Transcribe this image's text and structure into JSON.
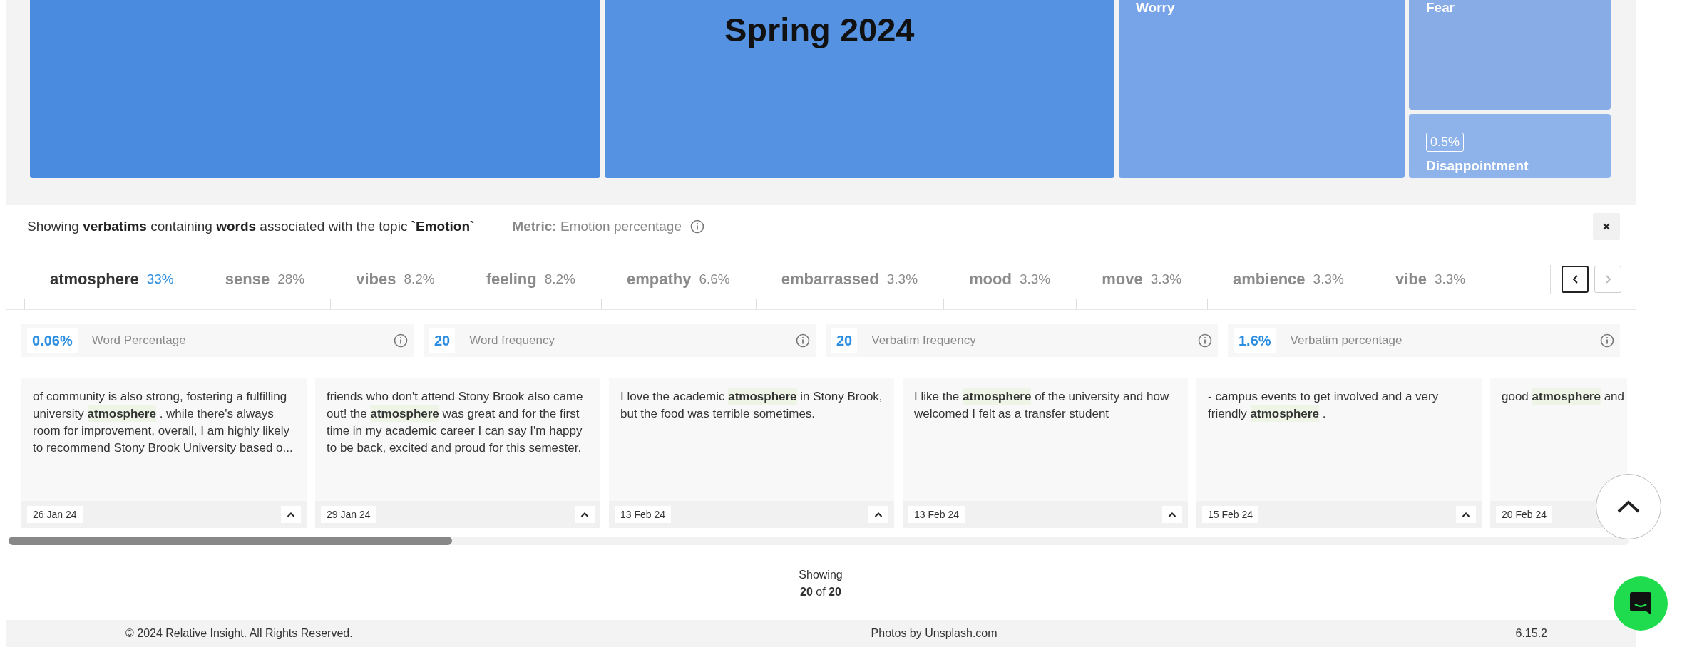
{
  "treemap": {
    "titles": [
      "Spring 2024"
    ],
    "columns": [
      [
        {
          "color": "#4a8be0"
        }
      ],
      [
        {
          "color": "#5592e2"
        }
      ],
      [
        {
          "label": "Worry",
          "color": "#77a4e8"
        }
      ],
      [
        {
          "label": "Fear",
          "color": "#88acE6"
        },
        {
          "label": "Disappointment",
          "badge": "0.5%",
          "color": "#8eb2ea"
        }
      ]
    ]
  },
  "panel": {
    "description": "Showing **verbatims** containing **words** associated with the topic **`Emotion`**",
    "metric": "**Metric:** Emotion percentage"
  },
  "tabs": [
    {
      "word": "atmosphere",
      "percent": "33%",
      "selected": true
    },
    {
      "word": "sense",
      "percent": "28%",
      "selected": false
    },
    {
      "word": "vibes",
      "percent": "8.2%",
      "selected": false
    },
    {
      "word": "feeling",
      "percent": "8.2%",
      "selected": false
    },
    {
      "word": "empathy",
      "percent": "6.6%",
      "selected": false
    },
    {
      "word": "embarrassed",
      "percent": "3.3%",
      "selected": false
    },
    {
      "word": "mood",
      "percent": "3.3%",
      "selected": false
    },
    {
      "word": "move",
      "percent": "3.3%",
      "selected": false
    },
    {
      "word": "ambience",
      "percent": "3.3%",
      "selected": false
    },
    {
      "word": "vibe",
      "percent": "3.3%",
      "selected": false
    }
  ],
  "tab_nav": {
    "previous_disabled": false,
    "next_disabled": true
  },
  "metrics": [
    {
      "value": "0.06%",
      "label": "Word Percentage"
    },
    {
      "value": "20",
      "label": "Word frequency"
    },
    {
      "value": "20",
      "label": "Verbatim frequency"
    },
    {
      "value": "1.6%",
      "label": "Verbatim percentage"
    }
  ],
  "verbatims": [
    {
      "text": "of community is also strong, fostering a fulfilling university **atmosphere** . while there's always room for improvement, overall, I am highly likely to recommend Stony Brook University based o...",
      "date": "26 Jan 24"
    },
    {
      "text": "friends who don't attend Stony Brook also came out! the **atmosphere** was great and for the first time in my academic career I can say I'm happy to be back, excited and proud for this semester.",
      "date": "29 Jan 24"
    },
    {
      "text": "I love the academic **atmosphere** in Stony Brook, but the food was terrible sometimes.",
      "date": "13 Feb 24"
    },
    {
      "text": "I like the **atmosphere** of the university and how welcomed I felt as a transfer student",
      "date": "13 Feb 24"
    },
    {
      "text": "- campus events to get involved and a very friendly **atmosphere** .",
      "date": "15 Feb 24"
    },
    {
      "text": "good **atmosphere** and",
      "date": "20 Feb 24"
    }
  ],
  "showing": {
    "label": "Showing",
    "count": "**20** of **20**"
  },
  "footer": {
    "copyright": "© 2024 Relative Insight. All Rights Reserved.",
    "photos_prefix": "Photos by",
    "photos_link": "Unsplash.com",
    "version": "6.15.2"
  }
}
